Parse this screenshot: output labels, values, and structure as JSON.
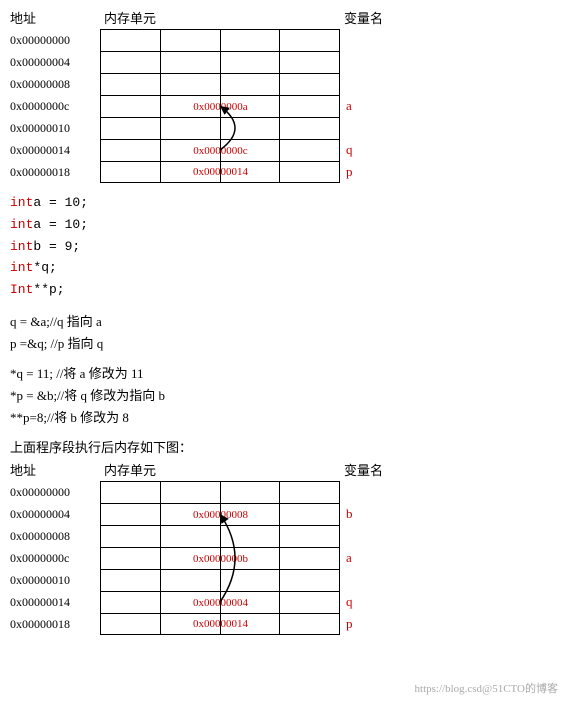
{
  "table1": {
    "headers": [
      "地址",
      "内存单元",
      "变量名"
    ],
    "rows": [
      {
        "addr": "0x00000000",
        "value": "",
        "span": false,
        "varname": ""
      },
      {
        "addr": "0x00000004",
        "value": "",
        "span": false,
        "varname": ""
      },
      {
        "addr": "0x00000008",
        "value": "",
        "span": false,
        "varname": ""
      },
      {
        "addr": "0x0000000c",
        "value": "0x0000000a",
        "span": true,
        "varname": "a"
      },
      {
        "addr": "0x00000010",
        "value": "",
        "span": false,
        "varname": ""
      },
      {
        "addr": "0x00000014",
        "value": "0x0000000c",
        "span": true,
        "varname": "q"
      },
      {
        "addr": "0x00000018",
        "value": "0x00000014",
        "span": true,
        "varname": "p"
      }
    ]
  },
  "code": {
    "lines": [
      {
        "keyword": "int",
        "rest": "  a = 10;"
      },
      {
        "keyword": "int",
        "rest": "  a = 10;"
      },
      {
        "keyword": "int",
        "rest": "  b = 9;"
      },
      {
        "keyword": "int",
        "rest": "  *q;"
      },
      {
        "keyword": "Int",
        "rest": "  **p;"
      }
    ]
  },
  "comments": {
    "lines": [
      "q = &a;//q  指向  a",
      "p =&q; //p  指向 q",
      "",
      "*q = 11; //将 a 修改为 11",
      "*p = &b;//将 q 修改为指向 b",
      "**p=8;//将  b 修改为 8"
    ]
  },
  "table2": {
    "title": "上面程序段执行后内存如下图：",
    "headers": [
      "地址",
      "内存单元",
      "变量名"
    ],
    "rows": [
      {
        "addr": "0x00000000",
        "value": "",
        "span": false,
        "varname": ""
      },
      {
        "addr": "0x00000004",
        "value": "0x00000008",
        "span": true,
        "varname": "b"
      },
      {
        "addr": "0x00000008",
        "value": "",
        "span": false,
        "varname": ""
      },
      {
        "addr": "0x0000000c",
        "value": "0x0000000b",
        "span": true,
        "varname": "a"
      },
      {
        "addr": "0x00000010",
        "value": "",
        "span": false,
        "varname": ""
      },
      {
        "addr": "0x00000014",
        "value": "0x00000004",
        "span": true,
        "varname": "q"
      },
      {
        "addr": "0x00000018",
        "value": "0x00000014",
        "span": true,
        "varname": "p"
      }
    ]
  },
  "watermark": "https://blog.csd@51CTO的博客"
}
